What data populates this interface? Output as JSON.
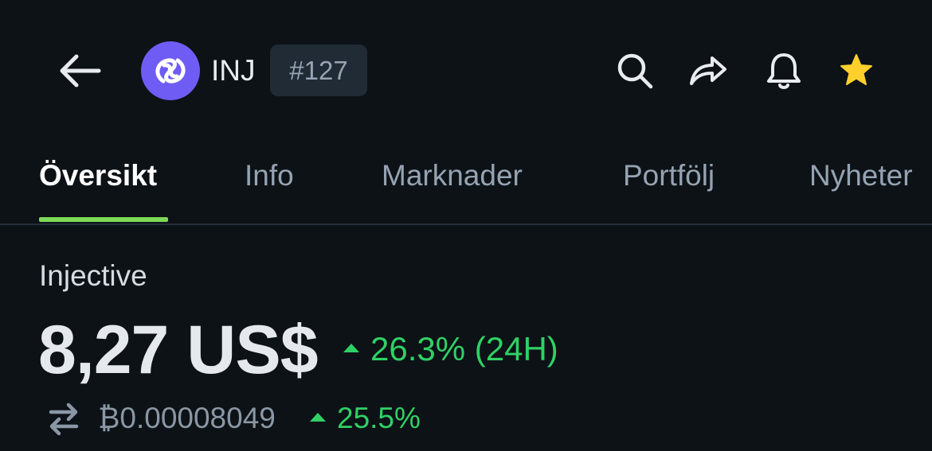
{
  "header": {
    "back_icon": "arrow-left-icon",
    "coin_logo_icon": "injective-logo-icon",
    "coin_symbol": "INJ",
    "rank": "#127",
    "actions": [
      "search-icon",
      "share-icon",
      "bell-icon",
      "star-icon"
    ]
  },
  "tabs": [
    {
      "label": "Översikt",
      "active": true
    },
    {
      "label": "Info",
      "active": false
    },
    {
      "label": "Marknader",
      "active": false
    },
    {
      "label": "Portfölj",
      "active": false
    },
    {
      "label": "Nyheter",
      "active": false
    }
  ],
  "overview": {
    "coin_name": "Injective",
    "price": "8,27 US$",
    "change_24h": "26.3% (24H)",
    "btc_price": "₿0.00008049",
    "btc_change": "25.5%"
  },
  "colors": {
    "background": "#0d1217",
    "accent_green": "#2fd164",
    "tab_indicator": "#7ed957",
    "star": "#ffd02b",
    "logo": "#6f5cf5"
  }
}
